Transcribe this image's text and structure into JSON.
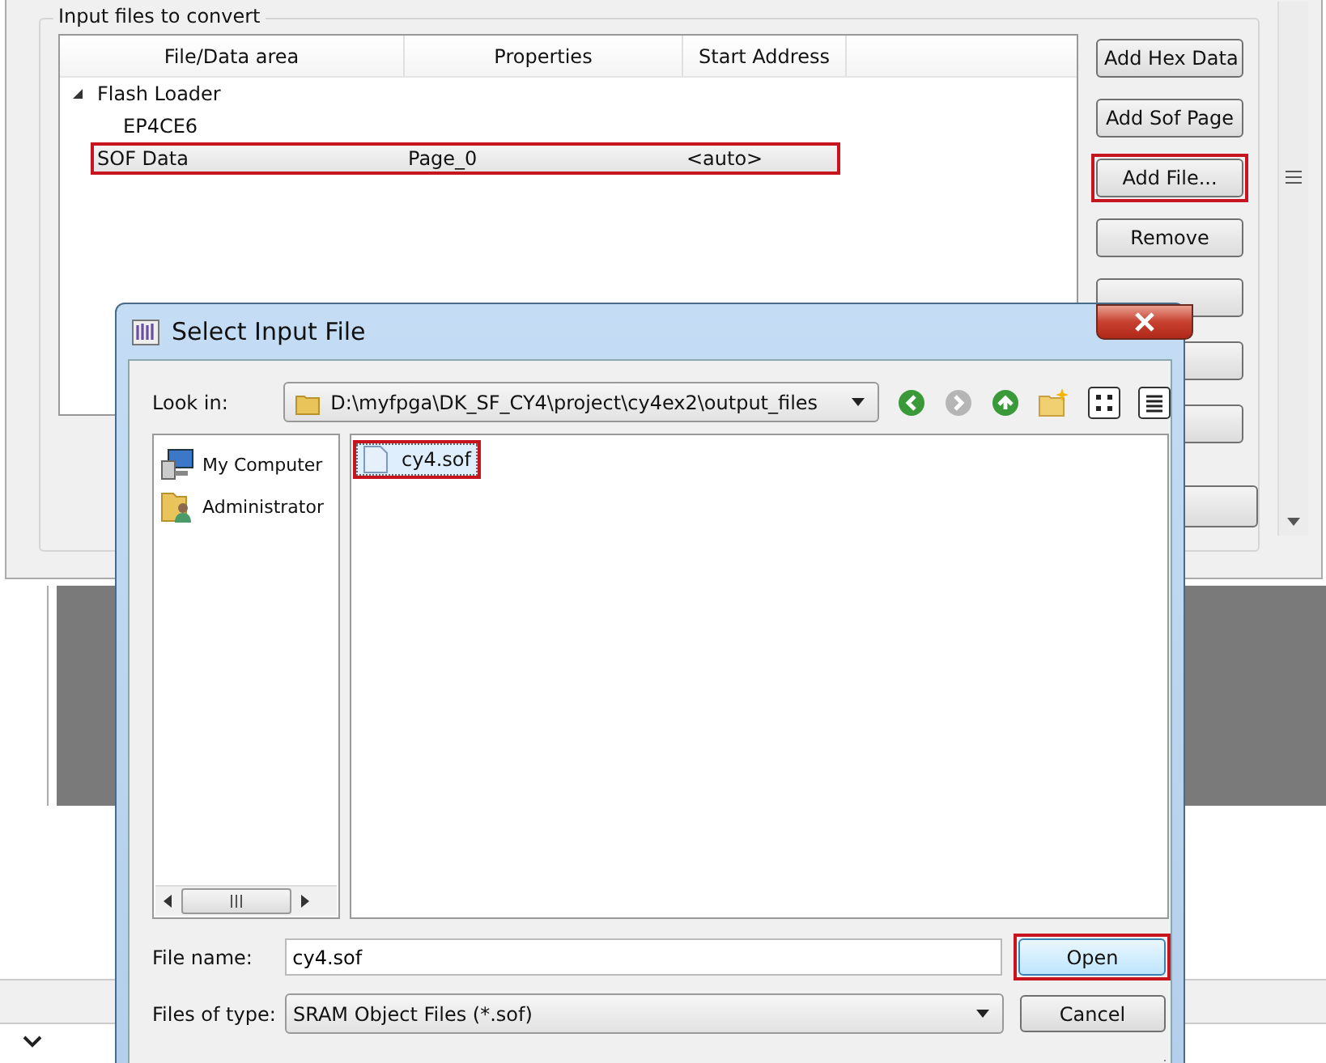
{
  "background_window": {
    "group_title": "Input files to convert",
    "table": {
      "columns": [
        "File/Data area",
        "Properties",
        "Start Address"
      ],
      "rows": [
        {
          "cells": [
            "Flash Loader"
          ],
          "expanded": true,
          "selected": false,
          "marked": false,
          "children": [
            {
              "cells": [
                "EP4CE6"
              ],
              "selected": false,
              "marked": false
            }
          ]
        },
        {
          "cells": [
            "SOF Data",
            "Page_0",
            "<auto>"
          ],
          "selected": true,
          "marked": true
        }
      ]
    },
    "buttons": [
      {
        "label": "Add Hex Data",
        "marked": false
      },
      {
        "label": "Add Sof Page",
        "marked": false
      },
      {
        "label": "Add File...",
        "marked": true
      },
      {
        "label": "Remove",
        "marked": false
      }
    ]
  },
  "dialog": {
    "title": "Select Input File",
    "look_in": {
      "label": "Look in:",
      "path": "D:\\myfpga\\DK_SF_CY4\\project\\cy4ex2\\output_files"
    },
    "places": [
      {
        "label": "My Computer",
        "kind": "computer"
      },
      {
        "label": "Administrator",
        "kind": "user"
      }
    ],
    "files": [
      {
        "name": "cy4.sof",
        "selected": true,
        "marked": true
      }
    ],
    "file_name": {
      "label": "File name:",
      "value": "cy4.sof"
    },
    "file_type": {
      "label": "Files of type:",
      "value": "SRAM Object Files (*.sof)"
    },
    "buttons": [
      {
        "label": "Open",
        "marked": true
      },
      {
        "label": "Cancel",
        "marked": false
      }
    ]
  }
}
